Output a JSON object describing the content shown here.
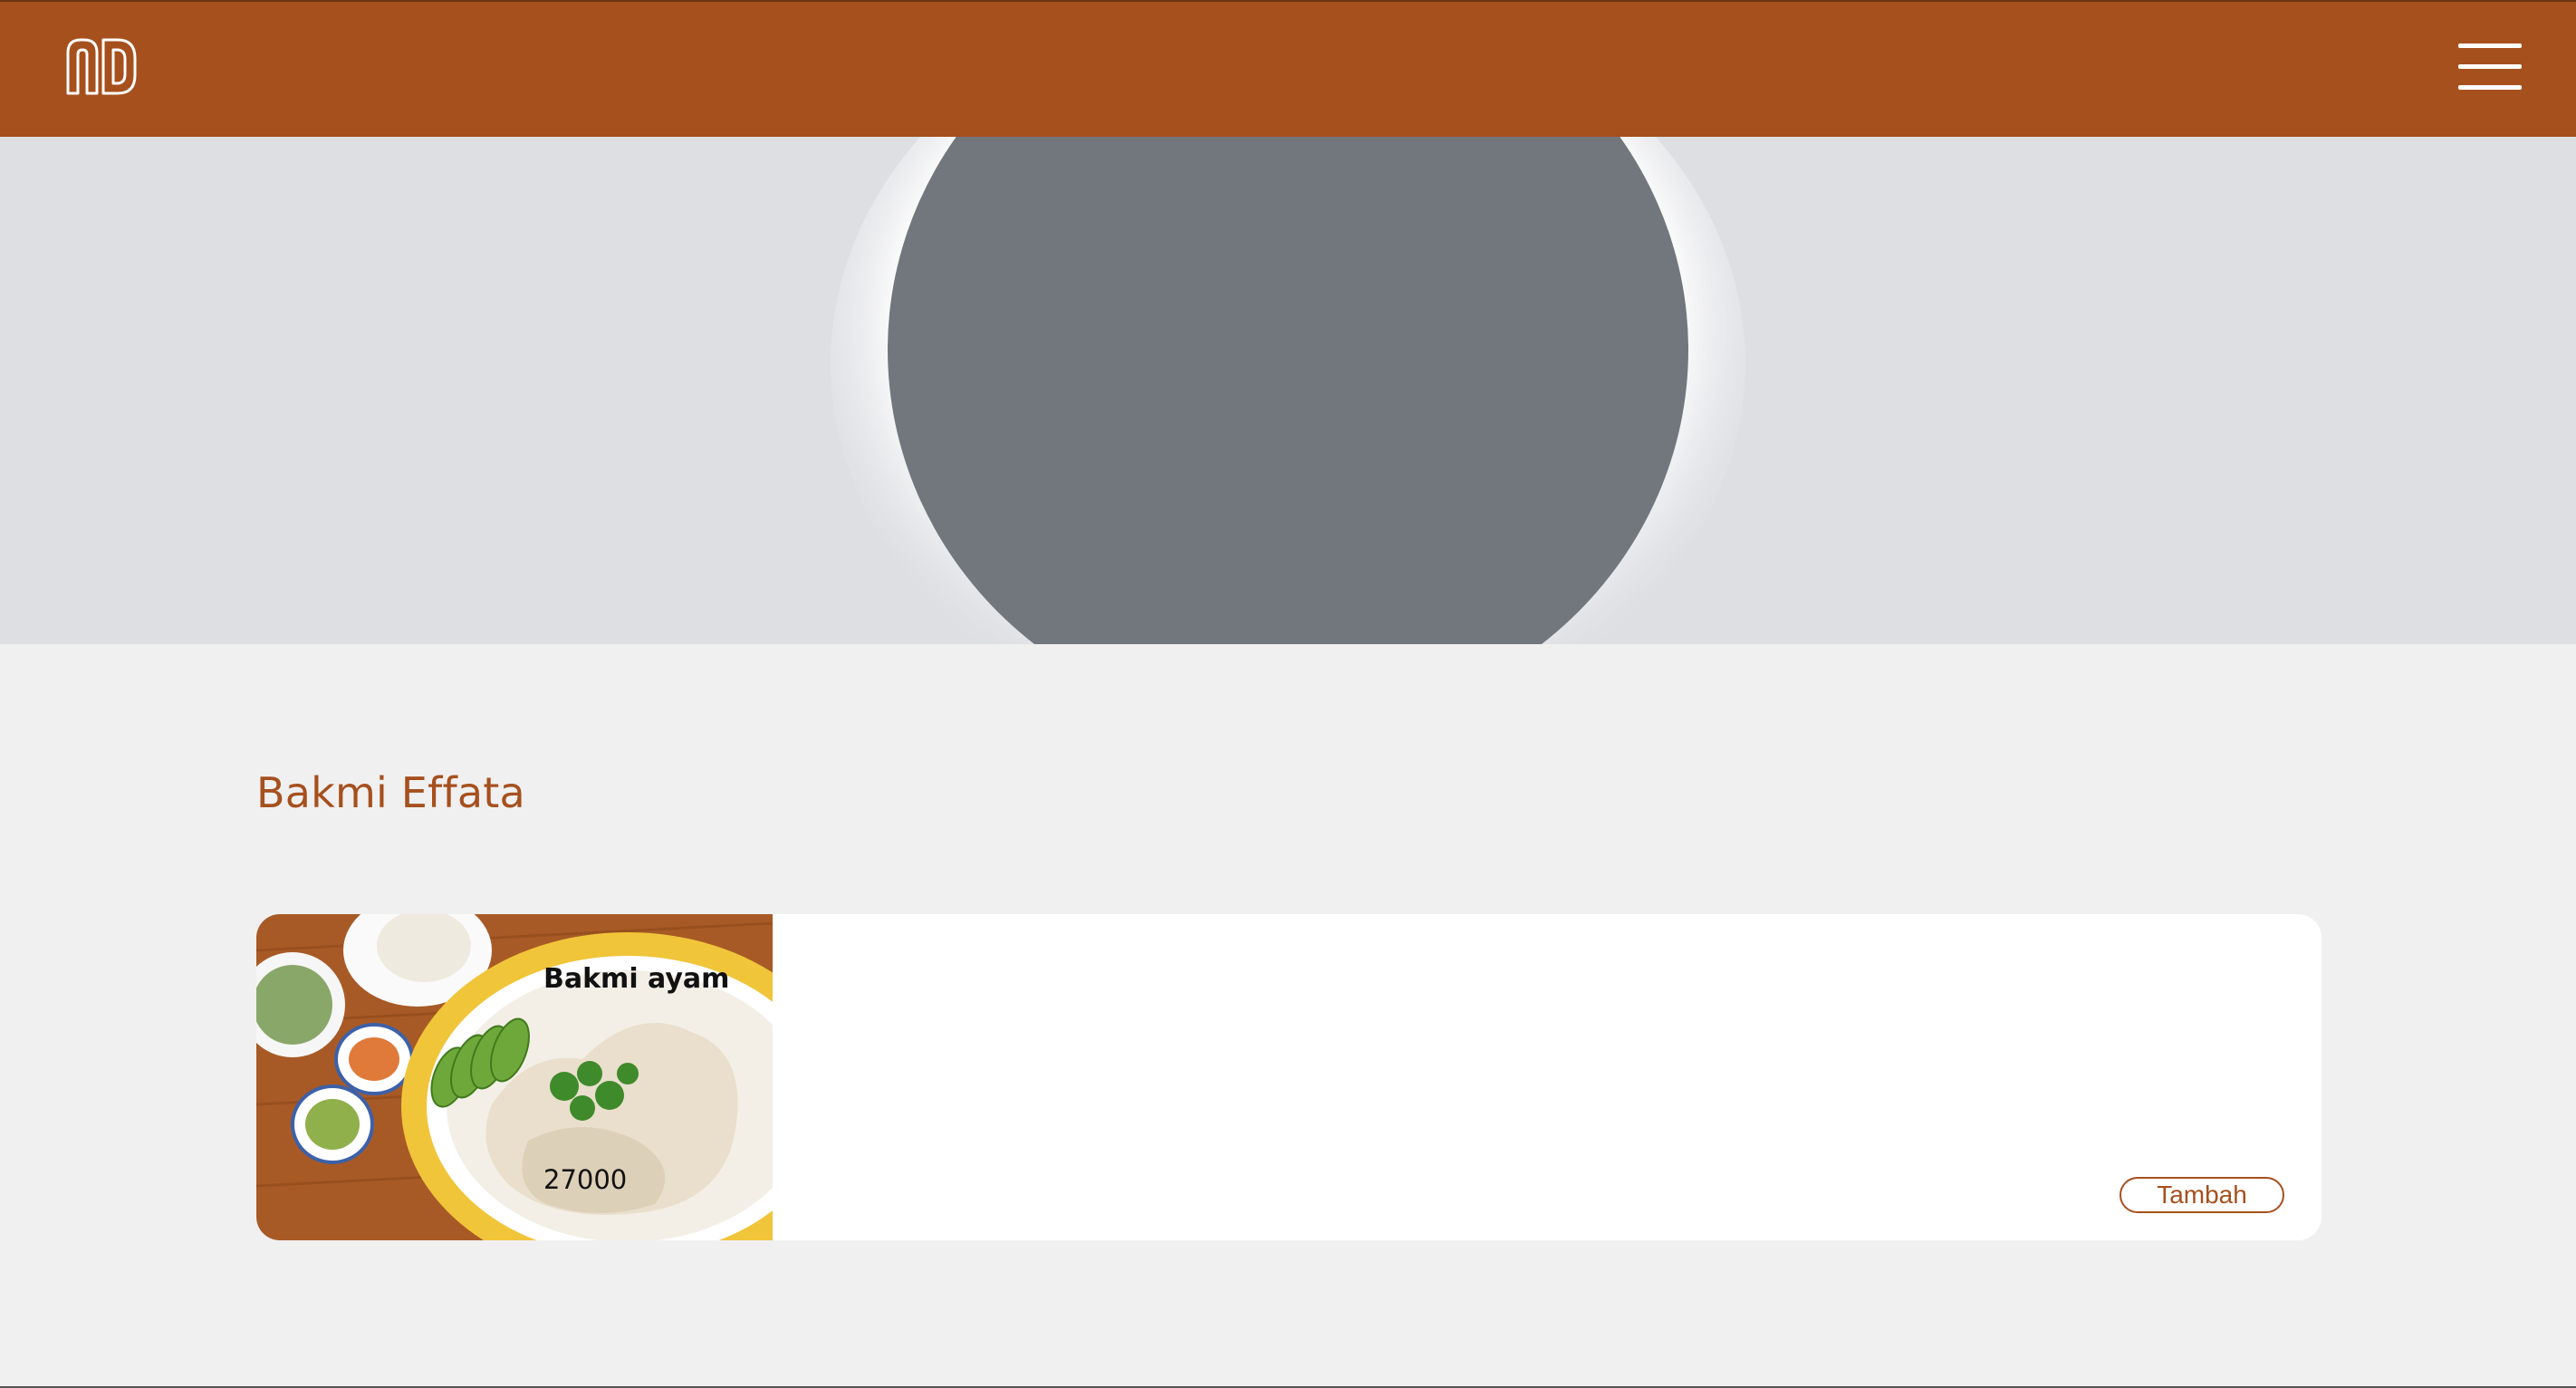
{
  "header": {
    "logo_icon": "nd-logo-icon",
    "menu_icon": "hamburger-menu-icon",
    "background_color": "#a6501e"
  },
  "hero": {
    "image": "placeholder-image"
  },
  "restaurant": {
    "name": "Bakmi Effata"
  },
  "menu_items": [
    {
      "name": "Bakmi ayam",
      "price": "27000",
      "add_label": "Tambah",
      "image": "chicken-rice-plate-photo"
    }
  ],
  "colors": {
    "brand": "#a6501e",
    "page_background": "#f0f0f0",
    "hero_background": "#dedfe3",
    "placeholder_shape": "#72767d"
  }
}
